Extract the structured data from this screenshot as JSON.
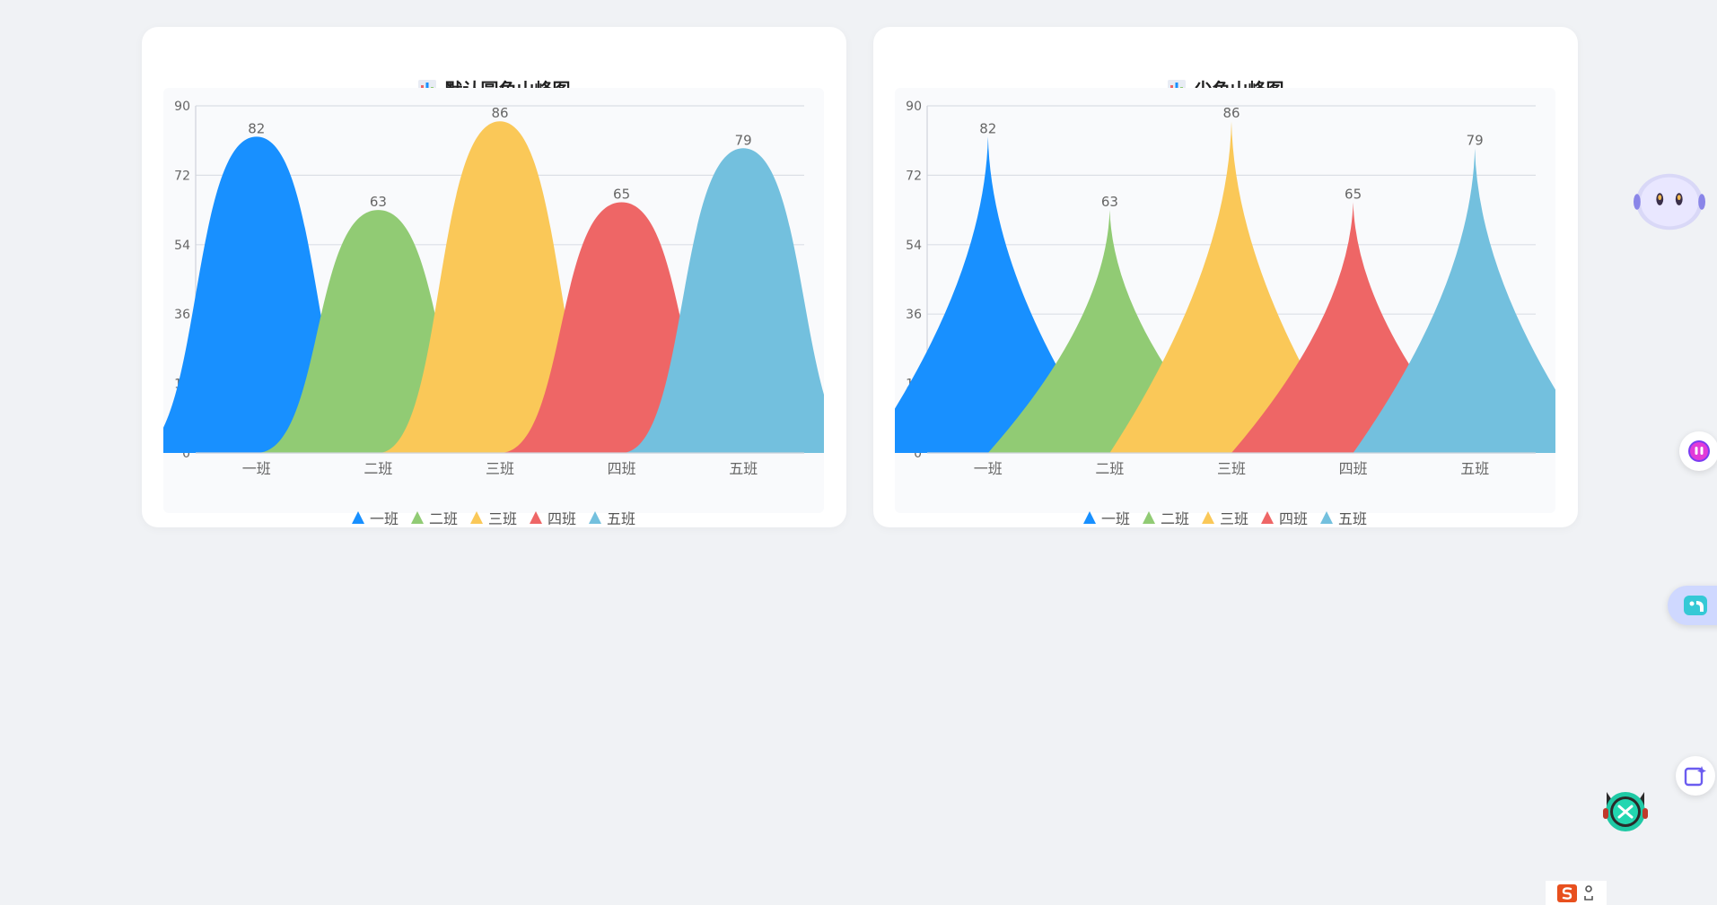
{
  "charts": [
    {
      "title": "默认圆角山峰图",
      "title_icon": "bar-chart-icon"
    },
    {
      "title": "尖角山峰图",
      "title_icon": "bar-chart-icon"
    }
  ],
  "chart_data": [
    {
      "type": "area",
      "style": "rounded-peak",
      "title": "默认圆角山峰图",
      "categories": [
        "一班",
        "二班",
        "三班",
        "四班",
        "五班"
      ],
      "values": [
        82,
        63,
        86,
        65,
        79
      ],
      "series_colors": [
        "#1890ff",
        "#91cb74",
        "#fac858",
        "#ee6666",
        "#73c0de"
      ],
      "ylim": [
        0,
        90
      ],
      "yticks": [
        0,
        18,
        36,
        54,
        72,
        90
      ],
      "grid": true,
      "legend": "bottom-center"
    },
    {
      "type": "area",
      "style": "sharp-peak",
      "title": "尖角山峰图",
      "categories": [
        "一班",
        "二班",
        "三班",
        "四班",
        "五班"
      ],
      "values": [
        82,
        63,
        86,
        65,
        79
      ],
      "series_colors": [
        "#1890ff",
        "#91cb74",
        "#fac858",
        "#ee6666",
        "#73c0de"
      ],
      "ylim": [
        0,
        90
      ],
      "yticks": [
        0,
        18,
        36,
        54,
        72,
        90
      ],
      "grid": true,
      "legend": "bottom-center"
    }
  ],
  "legend_items": [
    "一班",
    "二班",
    "三班",
    "四班",
    "五班"
  ],
  "side_widgets": [
    {
      "icon": "robot-assistant-icon"
    },
    {
      "icon": "chat-bubble-icon"
    },
    {
      "icon": "elephant-icon"
    },
    {
      "icon": "sparkle-edit-icon"
    },
    {
      "icon": "cat-mascot-icon"
    },
    {
      "icon": "s-logo-icon"
    }
  ]
}
